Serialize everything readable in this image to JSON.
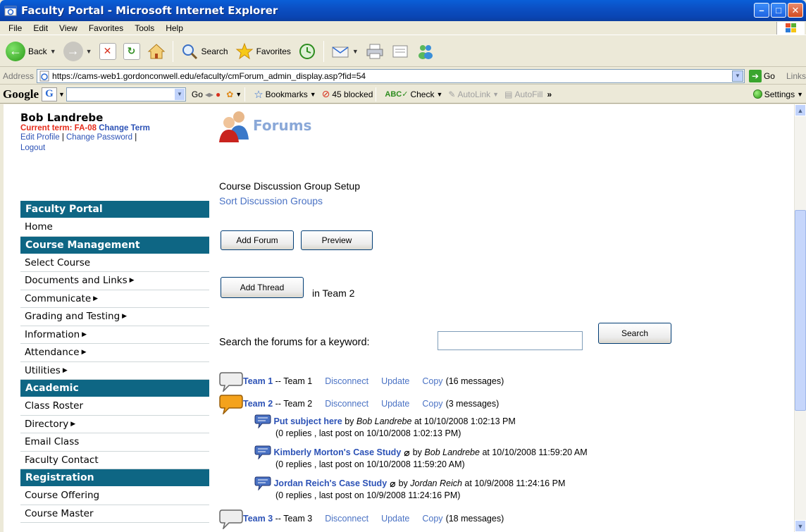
{
  "window": {
    "title": "Faculty Portal - Microsoft Internet Explorer"
  },
  "menu": [
    "File",
    "Edit",
    "View",
    "Favorites",
    "Tools",
    "Help"
  ],
  "toolbar": {
    "back": "Back",
    "search": "Search",
    "favorites": "Favorites"
  },
  "address": {
    "label": "Address",
    "url": "https://cams-web1.gordonconwell.edu/efaculty/cmForum_admin_display.asp?fid=54",
    "go": "Go",
    "links": "Links"
  },
  "google": {
    "logo": "Google",
    "box": "G",
    "go": "Go",
    "bookmarks": "Bookmarks",
    "blocked": "45 blocked",
    "check": "Check",
    "autolink": "AutoLink",
    "autofill": "AutoFill",
    "settings": "Settings"
  },
  "user": {
    "name": "Bob Landrebe",
    "current_term": "Current term: FA-08",
    "change_term": "Change Term",
    "edit_profile": "Edit Profile",
    "change_password": "Change Password",
    "logout": "Logout"
  },
  "nav": {
    "faculty_portal": "Faculty Portal",
    "home": "Home",
    "course_management": "Course Management",
    "select_course": "Select Course",
    "documents": "Documents and Links",
    "communicate": "Communicate",
    "grading": "Grading and Testing",
    "information": "Information",
    "attendance": "Attendance",
    "utilities": "Utilities",
    "academic": "Academic",
    "class_roster": "Class Roster",
    "directory": "Directory",
    "email_class": "Email Class",
    "faculty_contact": "Faculty Contact",
    "registration": "Registration",
    "course_offering": "Course Offering",
    "course_master": "Course Master"
  },
  "main": {
    "title": "Forums",
    "setup": "Course Discussion Group Setup",
    "sort": "Sort Discussion Groups",
    "add_forum": "Add Forum",
    "preview": "Preview",
    "add_thread": "Add Thread",
    "in_team": "in Team 2",
    "search_label": "Search the forums for a keyword:",
    "search_value": "",
    "search_button": "Search"
  },
  "forums": [
    {
      "name": "Team 1",
      "desc": "-- Team 1",
      "disconnect": "Disconnect",
      "update": "Update",
      "copy": "Copy",
      "count": "(16 messages)"
    },
    {
      "name": "Team 2",
      "desc": "-- Team 2",
      "disconnect": "Disconnect",
      "update": "Update",
      "copy": "Copy",
      "count": "(3 messages)"
    },
    {
      "name": "Team 3",
      "desc": "-- Team 3",
      "disconnect": "Disconnect",
      "update": "Update",
      "copy": "Copy",
      "count": "(18 messages)"
    }
  ],
  "threads": [
    {
      "title": "Put subject here",
      "by": "by",
      "author": "Bob Landrebe",
      "at": "at 10/10/2008 1:02:13 PM",
      "replies": "(0 replies , last post on 10/10/2008 1:02:13 PM)"
    },
    {
      "title": "Kimberly Morton's Case Study",
      "by": "by",
      "author": "Bob Landrebe",
      "at": "at 10/10/2008 11:59:20 AM",
      "replies": "(0 replies , last post on 10/10/2008 11:59:20 AM)"
    },
    {
      "title": "Jordan Reich's Case Study",
      "by": "by",
      "author": "Jordan Reich",
      "at": "at 10/9/2008 11:24:16 PM",
      "replies": "(0 replies , last post on 10/9/2008 11:24:16 PM)"
    }
  ]
}
